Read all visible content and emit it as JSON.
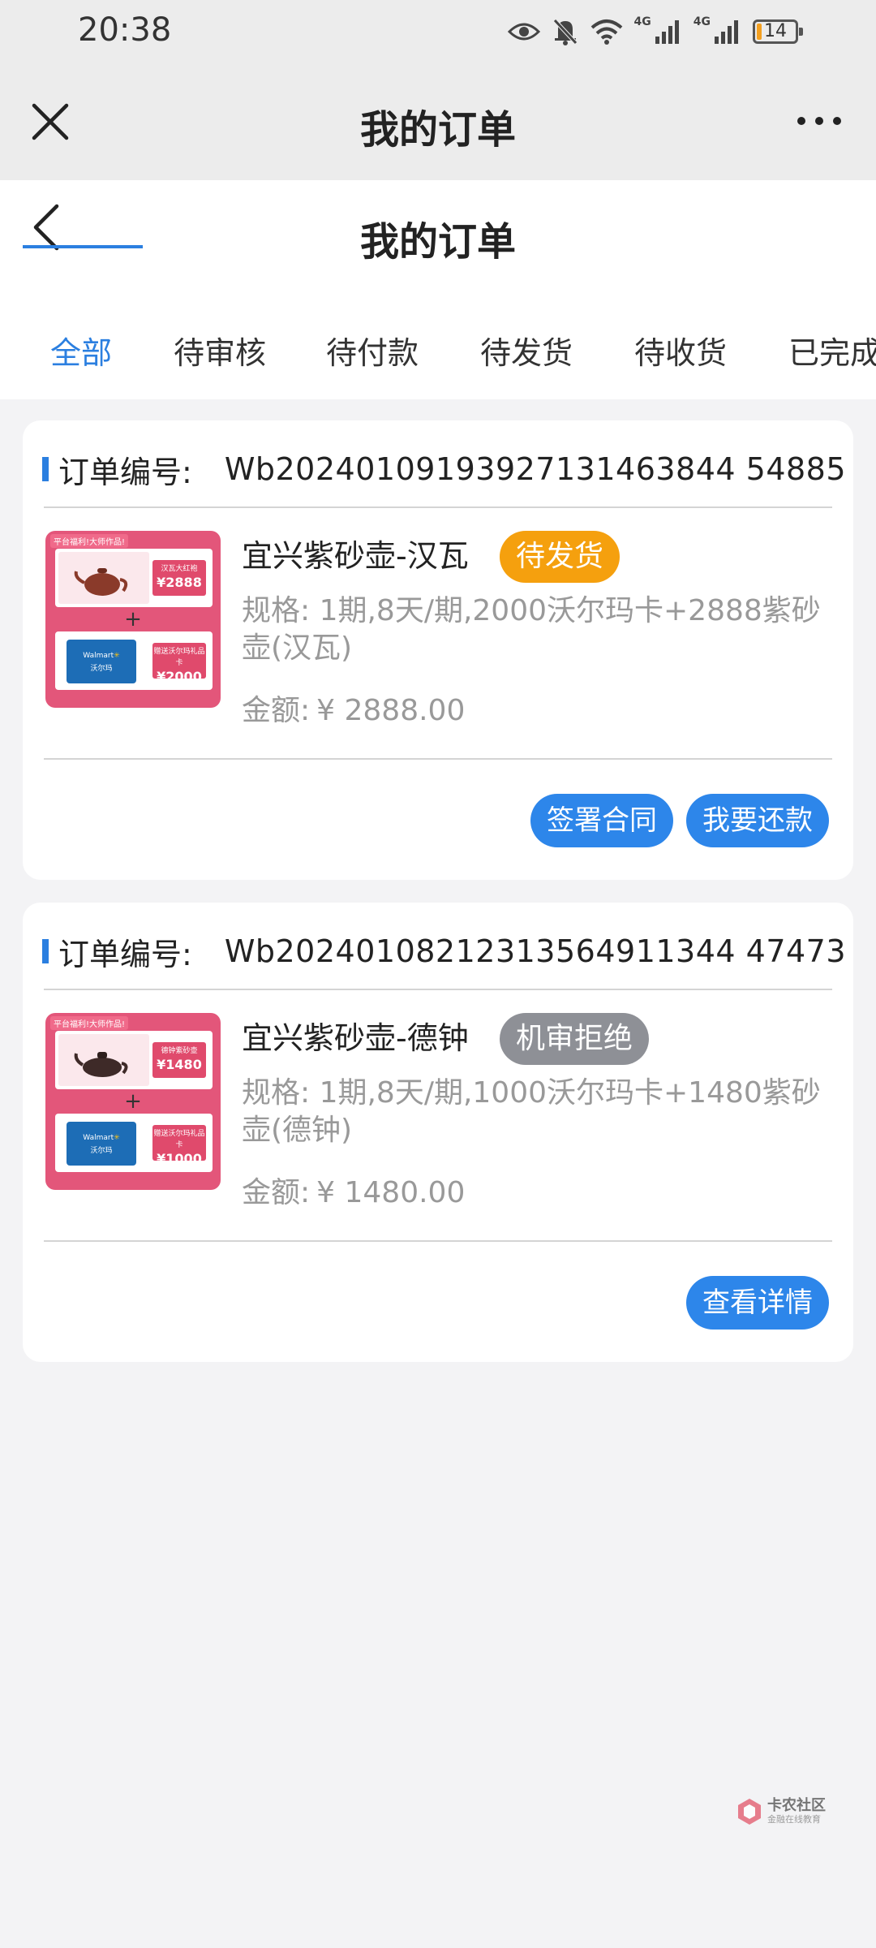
{
  "status_bar": {
    "time": "20:38",
    "network_1": "4G",
    "network_2": "4G",
    "battery": "14",
    "battery_level": 0.14,
    "icons": [
      "eye-icon",
      "bell-muted-icon",
      "wifi-icon",
      "signal-icon",
      "signal-icon",
      "battery-icon"
    ]
  },
  "mini_program_bar": {
    "title": "我的订单",
    "close_icon": "close-icon",
    "more_icon": "more-icon"
  },
  "page_header": {
    "title": "我的订单",
    "back_icon": "chevron-left-icon"
  },
  "tabs": [
    {
      "label": "全部",
      "active": true
    },
    {
      "label": "待审核",
      "active": false
    },
    {
      "label": "待付款",
      "active": false
    },
    {
      "label": "待发货",
      "active": false
    },
    {
      "label": "待收货",
      "active": false
    },
    {
      "label": "已完成",
      "active": false
    }
  ],
  "orders": [
    {
      "order_no_label": "订单编号:",
      "order_no": "Wb20240109193927131463844 54885",
      "product_name": "宜兴紫砂壶-汉瓦",
      "status": "待发货",
      "status_color": "#f5a00e",
      "spec": "规格: 1期,8天/期,2000沃尔玛卡+2888紫砂壶(汉瓦)",
      "amount_label": "金额:",
      "amount": "¥ 2888.00",
      "thumb": {
        "banner": "平台福利!大师作品!",
        "pot_label": "汉瓦大红袍",
        "pot_price": "¥2888",
        "plus": "+",
        "card_brand": "Walmart",
        "card_brand_cn": "沃尔玛",
        "card_label": "赠送沃尔玛礼品卡",
        "card_price": "¥2000"
      },
      "buttons": [
        "签署合同",
        "我要还款"
      ]
    },
    {
      "order_no_label": "订单编号:",
      "order_no": "Wb20240108212313564911344 47473",
      "product_name": "宜兴紫砂壶-德钟",
      "status": "机审拒绝",
      "status_color": "#8e9096",
      "spec": "规格: 1期,8天/期,1000沃尔玛卡+1480紫砂壶(德钟)",
      "amount_label": "金额:",
      "amount": "¥ 1480.00",
      "thumb": {
        "banner": "平台福利!大师作品!",
        "pot_label": "德钟紫砂壶",
        "pot_price": "¥1480",
        "plus": "+",
        "card_brand": "Walmart",
        "card_brand_cn": "沃尔玛",
        "card_label": "赠送沃尔玛礼品卡",
        "card_price": "¥1000"
      },
      "buttons": [
        "查看详情"
      ]
    }
  ],
  "watermark": {
    "main": "卡农社区",
    "sub": "金融在线教育"
  },
  "colors": {
    "accent": "#2b7fe0",
    "button": "#2d86ea",
    "badge_orange": "#f5a00e",
    "badge_gray": "#8e9096",
    "page_bg": "#f3f3f5"
  }
}
